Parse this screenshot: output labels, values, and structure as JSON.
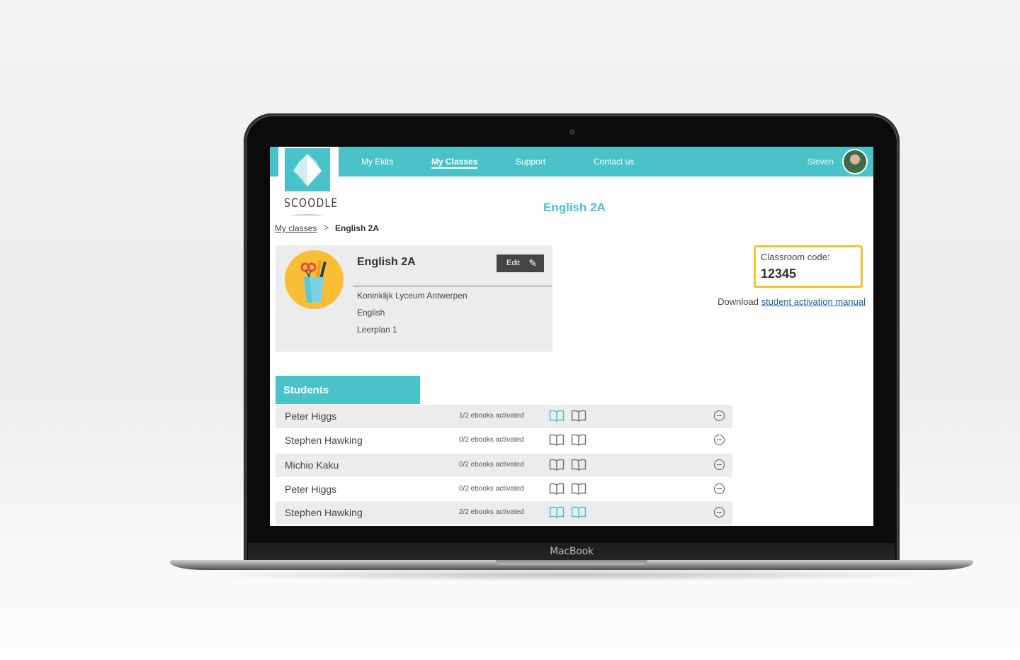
{
  "device": {
    "brand_label": "MacBook"
  },
  "app": {
    "logo_text": "SCOODLE"
  },
  "nav": {
    "items": [
      {
        "label": "My Ekits",
        "active": false
      },
      {
        "label": "My Classes",
        "active": true
      },
      {
        "label": "Support",
        "active": false
      },
      {
        "label": "Contact us",
        "active": false
      }
    ],
    "user": {
      "name": "Steven"
    }
  },
  "page": {
    "title": "English 2A"
  },
  "breadcrumb": {
    "parent": "My classes",
    "separator": ">",
    "current": "English 2A"
  },
  "class_card": {
    "name": "English 2A",
    "edit_label": "Edit",
    "school": "Koninklijk Lyceum Antwerpen",
    "subject": "English",
    "curriculum": "Leerplan 1"
  },
  "classroom": {
    "code_label": "Classroom code:",
    "code_value": "12345",
    "download_prefix": "Download",
    "download_link": "student activation manual"
  },
  "students": {
    "header": "Students",
    "rows": [
      {
        "name": "Peter Higgs",
        "status": "1/2 ebooks activated",
        "books": [
          true,
          false
        ]
      },
      {
        "name": "Stephen Hawking",
        "status": "0/2 ebooks activated",
        "books": [
          false,
          false
        ]
      },
      {
        "name": "Michio Kaku",
        "status": "0/2 ebooks activated",
        "books": [
          false,
          false
        ]
      },
      {
        "name": "Peter Higgs",
        "status": "0/2 ebooks activated",
        "books": [
          false,
          false
        ]
      },
      {
        "name": "Stephen Hawking",
        "status": "2/2 ebooks activated",
        "books": [
          true,
          true
        ]
      }
    ]
  },
  "colors": {
    "accent": "#49c3c9",
    "highlight": "#f6c228",
    "book_active": "#49c3c9",
    "book_inactive": "#777777"
  }
}
